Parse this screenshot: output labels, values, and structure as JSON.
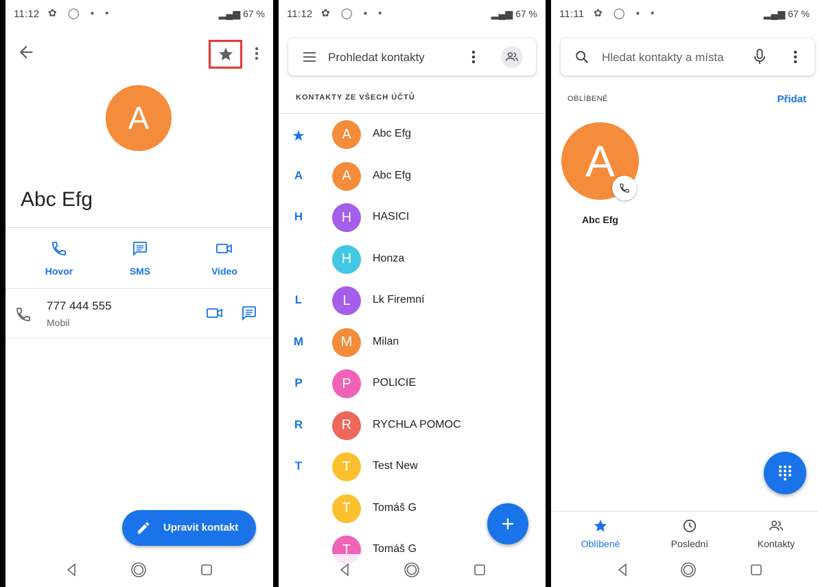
{
  "colors": {
    "accent": "#1a73e8",
    "orange": "#f48c3b",
    "purple": "#a45ee9",
    "cyan": "#42c8e2",
    "pink": "#f062b8",
    "red": "#ee675c",
    "yellow": "#fbc02d",
    "highlight": "#e53935"
  },
  "screen1": {
    "status": {
      "time": "11:12",
      "battery": "67 %"
    },
    "avatar_letter": "A",
    "contact_name": "Abc Efg",
    "actions": [
      {
        "label": "Hovor",
        "icon": "phone-icon"
      },
      {
        "label": "SMS",
        "icon": "message-icon"
      },
      {
        "label": "Video",
        "icon": "video-icon"
      }
    ],
    "phone": {
      "number": "777 444 555",
      "type": "Mobil"
    },
    "edit_button": "Upravit kontakt"
  },
  "screen2": {
    "status": {
      "time": "11:12",
      "battery": "67 %"
    },
    "search_placeholder": "Prohledat kontakty",
    "section_header": "KONTAKTY ZE VŠECH ÚČTŮ",
    "contacts": [
      {
        "index": "★",
        "letter": "A",
        "name": "Abc Efg",
        "color": "#f48c3b"
      },
      {
        "index": "A",
        "letter": "A",
        "name": "Abc Efg",
        "color": "#f48c3b"
      },
      {
        "index": "H",
        "letter": "H",
        "name": "HASICI",
        "color": "#a45ee9"
      },
      {
        "index": "",
        "letter": "H",
        "name": "Honza",
        "color": "#42c8e2"
      },
      {
        "index": "L",
        "letter": "L",
        "name": "Lk Firemní",
        "color": "#a45ee9"
      },
      {
        "index": "M",
        "letter": "M",
        "name": "Milan",
        "color": "#f48c3b"
      },
      {
        "index": "P",
        "letter": "P",
        "name": "POLICIE",
        "color": "#f062b8"
      },
      {
        "index": "R",
        "letter": "R",
        "name": "RYCHLA POMOC",
        "color": "#ee675c"
      },
      {
        "index": "T",
        "letter": "T",
        "name": "Test New",
        "color": "#fbc02d"
      },
      {
        "index": "",
        "letter": "T",
        "name": "Tomáš G",
        "color": "#fbc02d"
      },
      {
        "index": "",
        "letter": "T",
        "name": "Tomáš G",
        "color": "#f062b8"
      }
    ]
  },
  "screen3": {
    "status": {
      "time": "11:11",
      "battery": "67 %"
    },
    "search_placeholder": "Hledat kontakty a místa",
    "favorites_header": "OBLÍBENÉ",
    "add_label": "Přidat",
    "favorite": {
      "letter": "A",
      "name": "Abc Efg"
    },
    "tabs": [
      {
        "label": "Oblíbené",
        "icon": "star-icon",
        "active": true
      },
      {
        "label": "Poslední",
        "icon": "clock-icon",
        "active": false
      },
      {
        "label": "Kontakty",
        "icon": "contacts-icon",
        "active": false
      }
    ]
  }
}
